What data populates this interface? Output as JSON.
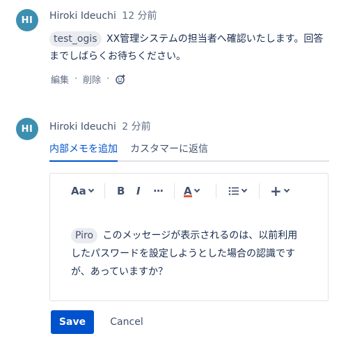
{
  "comments": [
    {
      "avatar_initials": "HI",
      "author": "Hiroki Ideuchi",
      "time": "12 分前",
      "mention": "test_ogis",
      "text_line1": "XX管理システムの担当者へ確認いたします。回答",
      "text_line2": "までしばらくお待ちください。",
      "actions": {
        "edit": "編集",
        "delete": "削除",
        "separator": "·"
      }
    }
  ],
  "reply": {
    "avatar_initials": "HI",
    "author": "Hiroki Ideuchi",
    "time": "2 分前",
    "tabs": [
      {
        "label": "内部メモを追加",
        "active": true
      },
      {
        "label": "カスタマーに返信",
        "active": false
      }
    ],
    "toolbar": {
      "text_style": "Aa",
      "bold": "B",
      "italic": "I",
      "more": "···",
      "color": "A",
      "color_underline": "#e2583e",
      "list_icon": "list-icon",
      "insert": "+"
    },
    "editor": {
      "mention": "Piro",
      "text_line1": "このメッセージが表示されるのは、以前利用",
      "text_line2": "したパスワードを設定しようとした場合の認識です",
      "text_line3": "が、あっていますか？"
    },
    "buttons": {
      "save": "Save",
      "cancel": "Cancel"
    }
  },
  "colors": {
    "accent": "#0052cc",
    "avatar": "#3d8fb0",
    "text": "#172b4d",
    "muted": "#5e6c84"
  }
}
